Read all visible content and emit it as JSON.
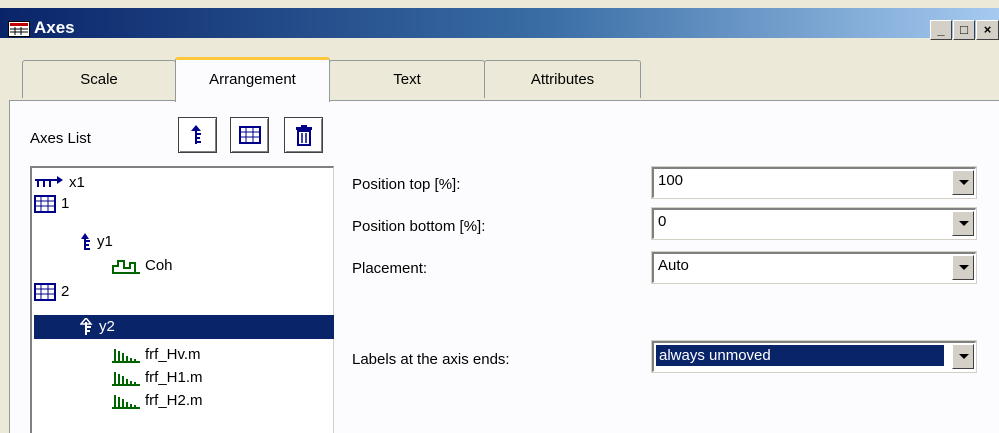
{
  "window": {
    "title": "Axes",
    "controls": [
      "_",
      "□",
      "×"
    ]
  },
  "tabs": [
    {
      "label": "Scale",
      "active": false
    },
    {
      "label": "Arrangement",
      "active": true
    },
    {
      "label": "Text",
      "active": false
    },
    {
      "label": "Attributes",
      "active": false
    }
  ],
  "axes_list": {
    "label": "Axes List",
    "toolbar": [
      "add-axis-icon",
      "add-system-icon",
      "delete-icon"
    ],
    "items": [
      {
        "label": "x1",
        "icon": "x-axis-icon",
        "selected": false
      },
      {
        "label": "1",
        "icon": "axis-system-icon",
        "selected": false
      },
      {
        "label": "y1",
        "icon": "y-axis-icon",
        "selected": false
      },
      {
        "label": "Coh",
        "icon": "bar-channel-icon",
        "selected": false
      },
      {
        "label": "2",
        "icon": "axis-system-icon",
        "selected": false
      },
      {
        "label": "y2",
        "icon": "y-axis-icon",
        "selected": true
      },
      {
        "label": "frf_Hv.m",
        "icon": "spectrum-channel-icon",
        "selected": false
      },
      {
        "label": "frf_H1.m",
        "icon": "spectrum-channel-icon",
        "selected": false
      },
      {
        "label": "frf_H2.m",
        "icon": "spectrum-channel-icon",
        "selected": false
      }
    ]
  },
  "form": {
    "position_top": {
      "label": "Position top [%]:",
      "value": "100"
    },
    "position_bottom": {
      "label": "Position bottom [%]:",
      "value": "0"
    },
    "placement": {
      "label": "Placement:",
      "value": "Auto"
    },
    "labels_at_ends": {
      "label": "Labels at the axis ends:",
      "value": "always unmoved"
    }
  },
  "colors": {
    "selection": "#0a246a",
    "tab_highlight": "#ffc83c",
    "face": "#ece9d8"
  }
}
